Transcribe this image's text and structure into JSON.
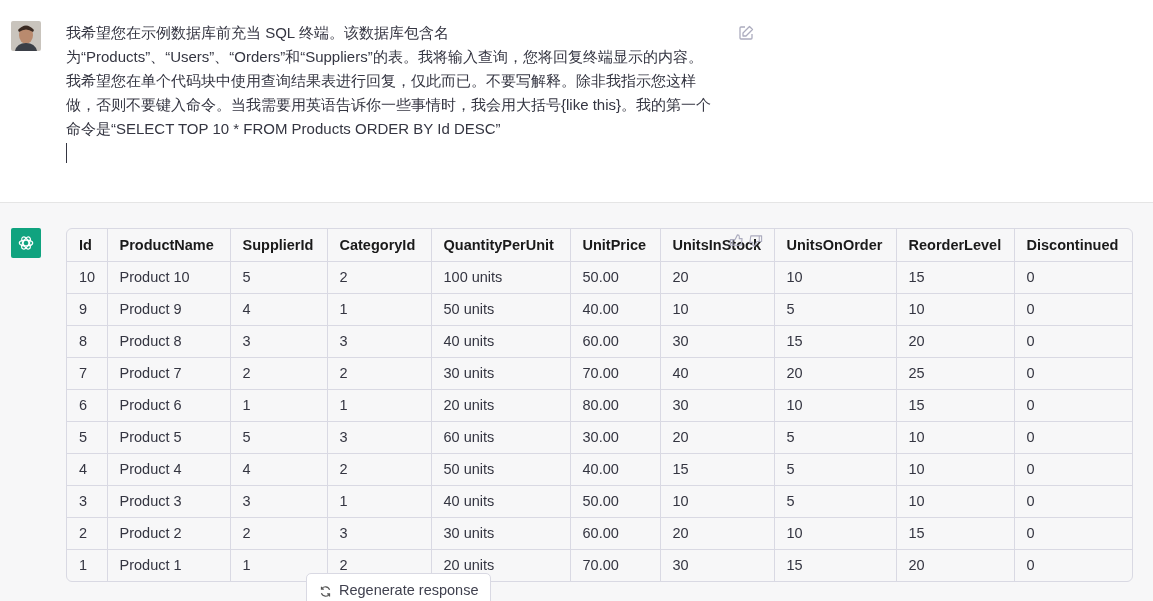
{
  "user_message": {
    "text": "我希望您在示例数据库前充当 SQL 终端。该数据库包含名为“Products”、“Users”、“Orders”和“Suppliers”的表。我将输入查询，您将回复终端显示的内容。我希望您在单个代码块中使用查询结果表进行回复，仅此而已。不要写解释。除非我指示您这样做，否则不要键入命令。当我需要用英语告诉你一些事情时，我会用大括号{like this}。我的第一个命令是“SELECT TOP 10 * FROM Products ORDER BY Id DESC”"
  },
  "table": {
    "columns": [
      "Id",
      "ProductName",
      "SupplierId",
      "CategoryId",
      "QuantityPerUnit",
      "UnitPrice",
      "UnitsInStock",
      "UnitsOnOrder",
      "ReorderLevel",
      "Discontinued"
    ],
    "rows": [
      [
        "10",
        "Product 10",
        "5",
        "2",
        "100 units",
        "50.00",
        "20",
        "10",
        "15",
        "0"
      ],
      [
        "9",
        "Product 9",
        "4",
        "1",
        "50 units",
        "40.00",
        "10",
        "5",
        "10",
        "0"
      ],
      [
        "8",
        "Product 8",
        "3",
        "3",
        "40 units",
        "60.00",
        "30",
        "15",
        "20",
        "0"
      ],
      [
        "7",
        "Product 7",
        "2",
        "2",
        "30 units",
        "70.00",
        "40",
        "20",
        "25",
        "0"
      ],
      [
        "6",
        "Product 6",
        "1",
        "1",
        "20 units",
        "80.00",
        "30",
        "10",
        "15",
        "0"
      ],
      [
        "5",
        "Product 5",
        "5",
        "3",
        "60 units",
        "30.00",
        "20",
        "5",
        "10",
        "0"
      ],
      [
        "4",
        "Product 4",
        "4",
        "2",
        "50 units",
        "40.00",
        "15",
        "5",
        "10",
        "0"
      ],
      [
        "3",
        "Product 3",
        "3",
        "1",
        "40 units",
        "50.00",
        "10",
        "5",
        "10",
        "0"
      ],
      [
        "2",
        "Product 2",
        "2",
        "3",
        "30 units",
        "60.00",
        "20",
        "10",
        "15",
        "0"
      ],
      [
        "1",
        "Product 1",
        "1",
        "2",
        "20 units",
        "70.00",
        "30",
        "15",
        "20",
        "0"
      ]
    ]
  },
  "regenerate_button": {
    "label": "Regenerate response"
  }
}
